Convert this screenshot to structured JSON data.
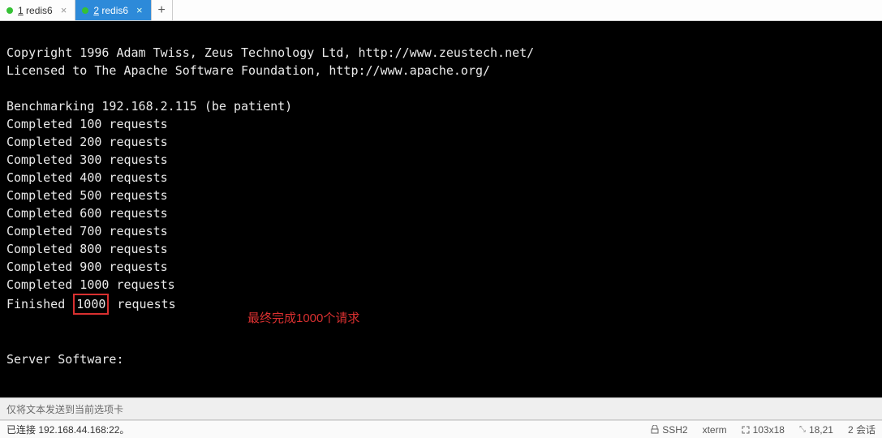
{
  "tabs": [
    {
      "num": "1",
      "label": "redis6",
      "active": false
    },
    {
      "num": "2",
      "label": "redis6",
      "active": true
    }
  ],
  "tab_add": "+",
  "terminal": {
    "line_copyright": "Copyright 1996 Adam Twiss, Zeus Technology Ltd, http://www.zeustech.net/",
    "line_licensed": "Licensed to The Apache Software Foundation, http://www.apache.org/",
    "blank1": "",
    "line_bench": "Benchmarking 192.168.2.115 (be patient)",
    "completed": [
      "Completed 100 requests",
      "Completed 200 requests",
      "Completed 300 requests",
      "Completed 400 requests",
      "Completed 500 requests",
      "Completed 600 requests",
      "Completed 700 requests",
      "Completed 800 requests",
      "Completed 900 requests",
      "Completed 1000 requests"
    ],
    "finished_prefix": "Finished ",
    "finished_value": "1000",
    "finished_suffix": " requests",
    "blank2": "",
    "blank3": "",
    "line_server": "Server Software:"
  },
  "annotation": "最终完成1000个请求",
  "infobar": "仅将文本发送到当前选项卡",
  "status": {
    "connected": "已连接 192.168.44.168:22。",
    "ssh": "SSH2",
    "term": "xterm",
    "size": "103x18",
    "pos": "18,21",
    "sessions": "2 会话"
  }
}
